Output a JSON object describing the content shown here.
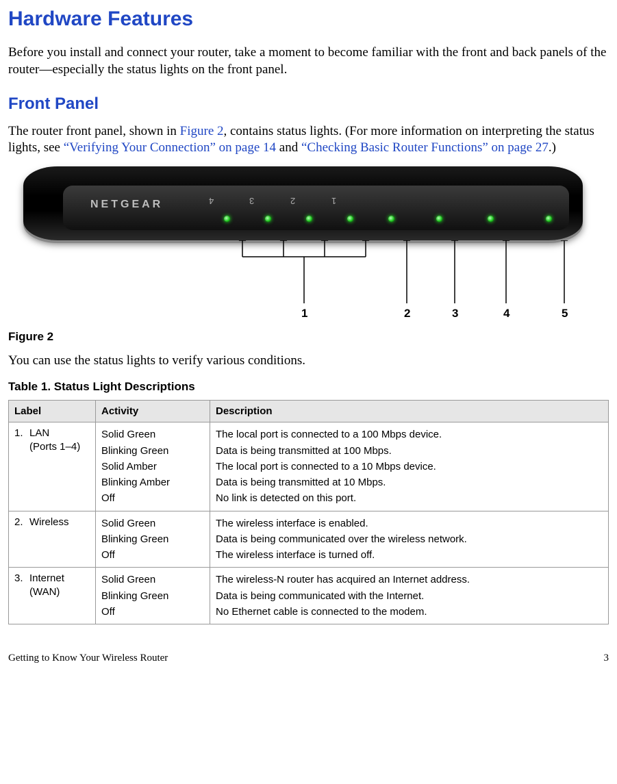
{
  "h1": "Hardware Features",
  "intro": "Before you install and connect your router, take a moment to become familiar with the front and back panels of the router—especially the status lights on the front panel.",
  "h2": "Front Panel",
  "fp_text_before_link1": "The router front panel, shown in ",
  "fp_link1": "Figure 2",
  "fp_text_mid1": ", contains status lights. (For more information on interpreting the status lights, see ",
  "fp_link2": "“Verifying Your Connection” on page 14",
  "fp_text_mid2": " and ",
  "fp_link3": "“Checking Basic Router Functions” on page 27",
  "fp_text_end": ".)",
  "router_brand": "NETGEAR",
  "port_labels": [
    "4",
    "3",
    "2",
    "1"
  ],
  "callout_numbers": [
    "1",
    "2",
    "3",
    "4",
    "5"
  ],
  "figure_caption": "Figure 2",
  "post_figure": "You can use the status lights to verify various conditions.",
  "table_caption": "Table 1.     Status Light Descriptions",
  "table": {
    "headers": [
      "Label",
      "Activity",
      "Description"
    ],
    "rows": [
      {
        "label_num": "1.",
        "label_text_l1": "LAN",
        "label_text_l2": "(Ports 1–4)",
        "activity": [
          "Solid Green",
          "Blinking Green",
          "Solid Amber",
          "Blinking Amber",
          "Off"
        ],
        "description": [
          "The local port is connected to a 100 Mbps device.",
          "Data is being transmitted at 100 Mbps.",
          "The local port is connected to a 10 Mbps device.",
          "Data is being transmitted at 10 Mbps.",
          "No link is detected on this port."
        ]
      },
      {
        "label_num": "2.",
        "label_text_l1": "Wireless",
        "label_text_l2": "",
        "activity": [
          "Solid Green",
          "Blinking Green",
          "Off"
        ],
        "description": [
          "The wireless interface is enabled.",
          "Data is being communicated over the wireless network.",
          "The wireless interface is turned off."
        ]
      },
      {
        "label_num": "3.",
        "label_text_l1": "Internet",
        "label_text_l2": "(WAN)",
        "activity": [
          "Solid Green",
          "Blinking Green",
          "Off"
        ],
        "description": [
          "The wireless-N router has acquired an Internet address.",
          "Data is being communicated with the Internet.",
          "No Ethernet cable is connected to the modem."
        ]
      }
    ]
  },
  "footer_left": "Getting to Know Your Wireless Router",
  "footer_right": "3"
}
